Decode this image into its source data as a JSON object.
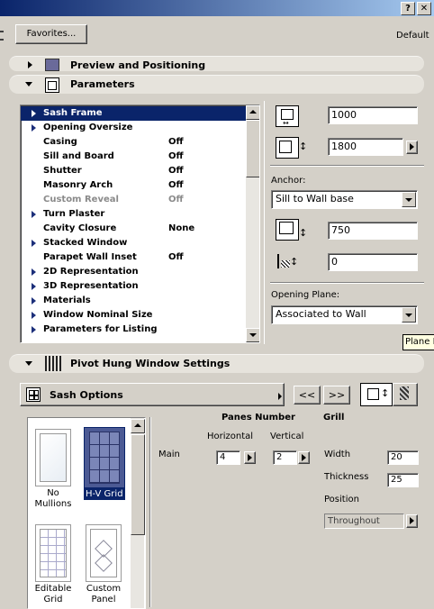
{
  "window": {
    "help_label": "?",
    "close_label": "✕"
  },
  "top": {
    "favorites_label": "Favorites...",
    "default_label": "Default"
  },
  "sections": {
    "preview": "Preview and Positioning",
    "parameters": "Parameters",
    "pivot": "Pivot Hung Window Settings"
  },
  "params_list": [
    {
      "label": "Sash Frame",
      "value": "",
      "expandable": true,
      "selected": true,
      "disabled": false
    },
    {
      "label": "Opening Oversize",
      "value": "",
      "expandable": true,
      "selected": false,
      "disabled": false
    },
    {
      "label": "Casing",
      "value": "Off",
      "expandable": false,
      "selected": false,
      "disabled": false
    },
    {
      "label": "Sill and Board",
      "value": "Off",
      "expandable": false,
      "selected": false,
      "disabled": false
    },
    {
      "label": "Shutter",
      "value": "Off",
      "expandable": false,
      "selected": false,
      "disabled": false
    },
    {
      "label": "Masonry Arch",
      "value": "Off",
      "expandable": false,
      "selected": false,
      "disabled": false
    },
    {
      "label": "Custom Reveal",
      "value": "Off",
      "expandable": false,
      "selected": false,
      "disabled": true
    },
    {
      "label": "Turn Plaster",
      "value": "",
      "expandable": true,
      "selected": false,
      "disabled": false
    },
    {
      "label": "Cavity Closure",
      "value": "None",
      "expandable": false,
      "selected": false,
      "disabled": false
    },
    {
      "label": "Stacked Window",
      "value": "",
      "expandable": true,
      "selected": false,
      "disabled": false
    },
    {
      "label": "Parapet Wall Inset",
      "value": "Off",
      "expandable": false,
      "selected": false,
      "disabled": false
    },
    {
      "label": "2D Representation",
      "value": "",
      "expandable": true,
      "selected": false,
      "disabled": false
    },
    {
      "label": "3D Representation",
      "value": "",
      "expandable": true,
      "selected": false,
      "disabled": false
    },
    {
      "label": "Materials",
      "value": "",
      "expandable": true,
      "selected": false,
      "disabled": false
    },
    {
      "label": "Window Nominal Size",
      "value": "",
      "expandable": true,
      "selected": false,
      "disabled": false
    },
    {
      "label": "Parameters for Listing",
      "value": "",
      "expandable": true,
      "selected": false,
      "disabled": false
    }
  ],
  "dimensions": {
    "width_value": "1000",
    "height_value": "1800",
    "anchor_label": "Anchor:",
    "anchor_value": "Sill to Wall base",
    "sill_height_value": "750",
    "offset_value": "0",
    "opening_plane_label": "Opening Plane:",
    "opening_plane_value": "Associated to Wall",
    "tooltip_text": "Plane D"
  },
  "pivot": {
    "panel_label": "Sash Options",
    "prev_label": "<<",
    "next_label": ">>"
  },
  "thumbnails": [
    {
      "label": "No Mullions",
      "selected": false
    },
    {
      "label": "H-V Grid",
      "selected": true
    },
    {
      "label": "Editable Grid",
      "selected": false
    },
    {
      "label": "Custom Panel",
      "selected": false
    }
  ],
  "panes": {
    "title": "Panes Number",
    "horizontal_label": "Horizontal",
    "vertical_label": "Vertical",
    "main_label": "Main",
    "horizontal_value": "4",
    "vertical_value": "2"
  },
  "grill": {
    "title": "Grill",
    "width_label": "Width",
    "width_value": "20",
    "thickness_label": "Thickness",
    "thickness_value": "25",
    "position_label": "Position",
    "position_value": "Throughout"
  },
  "colors": {
    "selection": "#0a246a",
    "face": "#d4d0c8",
    "title_start": "#0a246a",
    "title_end": "#a6caf0"
  }
}
